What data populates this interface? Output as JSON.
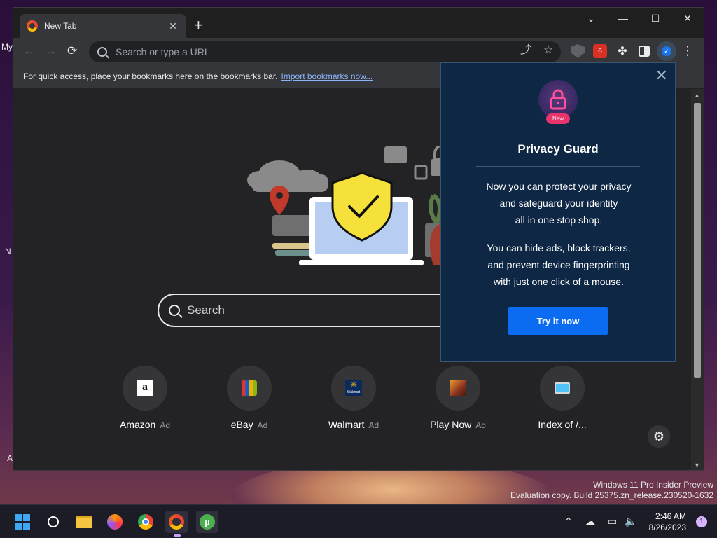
{
  "desktop": {
    "icon_labels": [
      "My",
      "N",
      "A"
    ],
    "watermark": {
      "line1": "Windows 11 Pro Insider Preview",
      "line2": "Evaluation copy. Build 25375.zn_release.230520-1632"
    }
  },
  "browser": {
    "tab_title": "New Tab",
    "omnibox_placeholder": "Search or type a URL",
    "bookmarks_bar": {
      "text": "For quick access, place your bookmarks here on the bookmarks bar.",
      "link": "Import bookmarks now..."
    },
    "ext_badge_count": "6"
  },
  "newtab": {
    "search_placeholder": "Search",
    "shortcuts": [
      {
        "label": "Amazon",
        "ad": "Ad",
        "icon": "amazon-icon"
      },
      {
        "label": "eBay",
        "ad": "Ad",
        "icon": "ebay-bag-icon"
      },
      {
        "label": "Walmart",
        "ad": "Ad",
        "icon": "walmart-icon"
      },
      {
        "label": "Play Now",
        "ad": "Ad",
        "icon": "game-icon"
      },
      {
        "label": "Index of /...",
        "ad": "",
        "icon": "monitor-icon"
      }
    ],
    "walmart_tile_text": "Walmart"
  },
  "popup": {
    "badge": "New",
    "title": "Privacy Guard",
    "para1": [
      "Now you can protect your privacy",
      "and safeguard your identity",
      "all in one stop shop."
    ],
    "para2": [
      "You can hide ads, block trackers,",
      "and prevent device fingerprinting",
      "with just one click of a mouse."
    ],
    "button": "Try it now"
  },
  "taskbar": {
    "time": "2:46 AM",
    "date": "8/26/2023",
    "notification_count": "1"
  },
  "colors": {
    "popup_bg": "#0e2744",
    "popup_button": "#0b6cf1",
    "link": "#8ab4f8",
    "shield_yellow": "#f5e13a"
  }
}
